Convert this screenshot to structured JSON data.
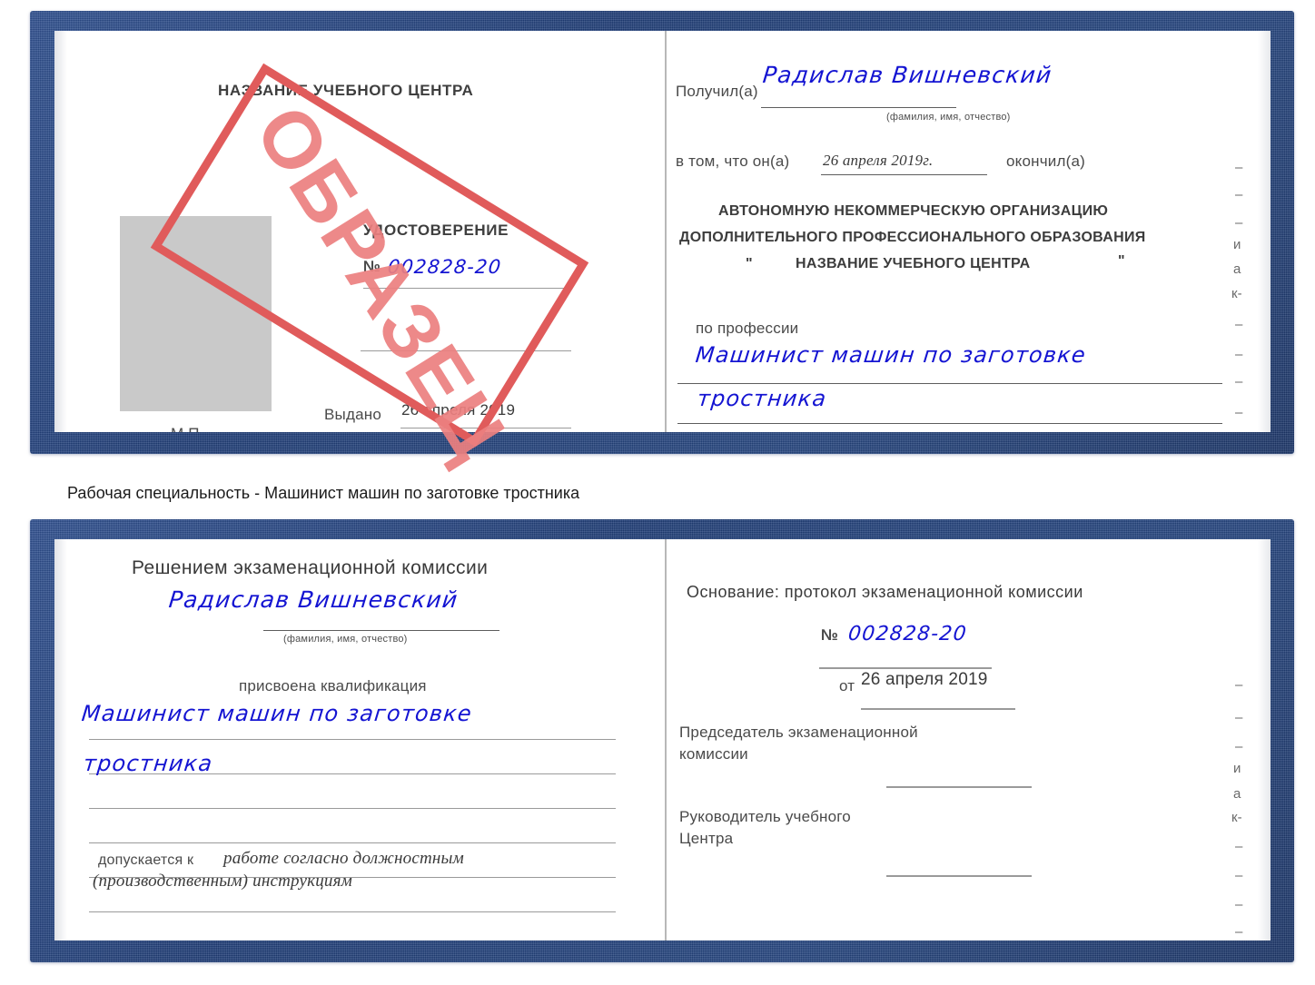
{
  "document": {
    "type": "certificate-scan",
    "language": "ru",
    "colors": {
      "cover_blue": "#23437c",
      "handwriting_blue": "#1414d2",
      "stamp_red": "#e05b5b",
      "stamp_text_red": "#ec8080",
      "photo_placeholder_grey": "#c9c9c9",
      "rule_grey": "#9a9a9a"
    }
  },
  "caption": {
    "text": "Рабочая специальность - Машинист машин по заготовке тростника"
  },
  "stamp": {
    "label": "ОБРАЗЕЦ"
  },
  "certificate_top": {
    "left_page": {
      "center_name": "НАЗВАНИЕ УЧЕБНОГО ЦЕНТРА",
      "title": "УДОСТОВЕРЕНИЕ",
      "number_label": "№",
      "number_value": "002828-20",
      "issued_label": "Выдано",
      "issued_value": "26 апреля 2019",
      "seal_label": "М.П."
    },
    "right_page": {
      "received_label": "Получил(а)",
      "received_value": "Радислав Вишневский",
      "fio_hint": "(фамилия, имя, отчество)",
      "in_that_label": "в том, что он(а)",
      "completion_date": "26 апреля 2019г.",
      "finished_label": "окончил(а)",
      "org_line1": "АВТОНОМНУЮ НЕКОММЕРЧЕСКУЮ ОРГАНИЗАЦИЮ",
      "org_line2": "ДОПОЛНИТЕЛЬНОГО ПРОФЕССИОНАЛЬНОГО ОБРАЗОВАНИЯ",
      "org_quote_open": "\"",
      "org_line3": "НАЗВАНИЕ УЧЕБНОГО ЦЕНТРА",
      "org_quote_close": "\"",
      "profession_label": "по профессии",
      "profession_value_line1": "Машинист машин по заготовке",
      "profession_value_line2": "тростника",
      "margin_chars": [
        "–",
        "–",
        "–",
        "и",
        "а",
        "к-",
        "–",
        "–",
        "–",
        "–"
      ]
    }
  },
  "certificate_bottom": {
    "left_page": {
      "title": "Решением экзаменационной комиссии",
      "name_value": "Радислав Вишневский",
      "fio_hint": "(фамилия, имя, отчество)",
      "qualification_label": "присвоена квалификация",
      "qualification_line1": "Машинист машин по заготовке",
      "qualification_line2": "тростника",
      "admitted_label": "допускается к",
      "admitted_value_line1": "работе согласно должностным",
      "admitted_value_line2": "(производственным) инструкциям"
    },
    "right_page": {
      "basis_label": "Основание: протокол экзаменационной комиссии",
      "number_label": "№",
      "number_value": "002828-20",
      "from_label": "от",
      "from_value": "26 апреля 2019",
      "chairman_line1": "Председатель экзаменационной",
      "chairman_line2": "комиссии",
      "head_line1": "Руководитель учебного",
      "head_line2": "Центра",
      "margin_chars": [
        "–",
        "–",
        "–",
        "и",
        "а",
        "к-",
        "–",
        "–",
        "–",
        "–"
      ]
    }
  }
}
